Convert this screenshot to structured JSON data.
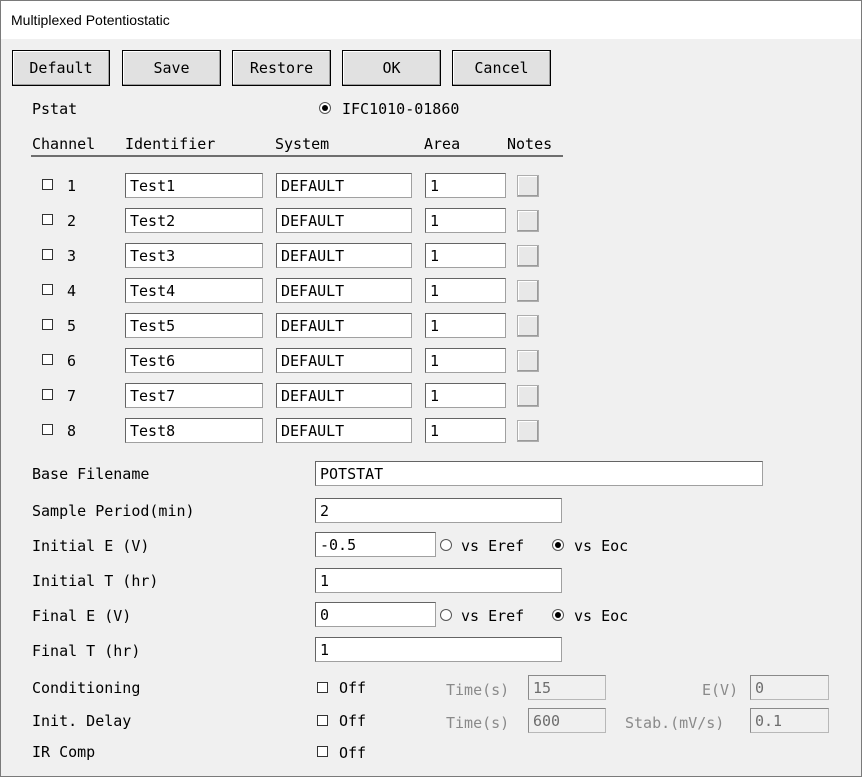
{
  "window": {
    "title": "Multiplexed Potentiostatic"
  },
  "toolbar": {
    "default": "Default",
    "save": "Save",
    "restore": "Restore",
    "ok": "OK",
    "cancel": "Cancel"
  },
  "pstat": {
    "label": "Pstat",
    "option": "IFC1010-01860"
  },
  "table": {
    "headers": {
      "channel": "Channel",
      "identifier": "Identifier",
      "system": "System",
      "area": "Area",
      "notes": "Notes"
    },
    "rows": [
      {
        "channel": "1",
        "identifier": "Test1",
        "system": "DEFAULT",
        "area": "1",
        "checked": false
      },
      {
        "channel": "2",
        "identifier": "Test2",
        "system": "DEFAULT",
        "area": "1",
        "checked": false
      },
      {
        "channel": "3",
        "identifier": "Test3",
        "system": "DEFAULT",
        "area": "1",
        "checked": false
      },
      {
        "channel": "4",
        "identifier": "Test4",
        "system": "DEFAULT",
        "area": "1",
        "checked": false
      },
      {
        "channel": "5",
        "identifier": "Test5",
        "system": "DEFAULT",
        "area": "1",
        "checked": false
      },
      {
        "channel": "6",
        "identifier": "Test6",
        "system": "DEFAULT",
        "area": "1",
        "checked": false
      },
      {
        "channel": "7",
        "identifier": "Test7",
        "system": "DEFAULT",
        "area": "1",
        "checked": false
      },
      {
        "channel": "8",
        "identifier": "Test8",
        "system": "DEFAULT",
        "area": "1",
        "checked": false
      }
    ]
  },
  "form": {
    "base_filename": {
      "label": "Base Filename",
      "value": "POTSTAT"
    },
    "sample_period": {
      "label": "Sample Period(min)",
      "value": "2"
    },
    "initial_e": {
      "label": "Initial E (V)",
      "value": "-0.5",
      "vs_eref": "vs Eref",
      "vs_eoc": "vs Eoc",
      "selected": "vs Eoc"
    },
    "initial_t": {
      "label": "Initial T (hr)",
      "value": "1"
    },
    "final_e": {
      "label": "Final E (V)",
      "value": "0",
      "vs_eref": "vs Eref",
      "vs_eoc": "vs Eoc",
      "selected": "vs Eoc"
    },
    "final_t": {
      "label": "Final T (hr)",
      "value": "1"
    },
    "conditioning": {
      "label": "Conditioning",
      "toggle": "Off",
      "time_label": "Time(s)",
      "time_value": "15",
      "e_label": "E(V)",
      "e_value": "0"
    },
    "init_delay": {
      "label": "Init. Delay",
      "toggle": "Off",
      "time_label": "Time(s)",
      "time_value": "600",
      "stab_label": "Stab.(mV/s)",
      "stab_value": "0.1"
    },
    "ir_comp": {
      "label": "IR Comp",
      "toggle": "Off"
    }
  }
}
